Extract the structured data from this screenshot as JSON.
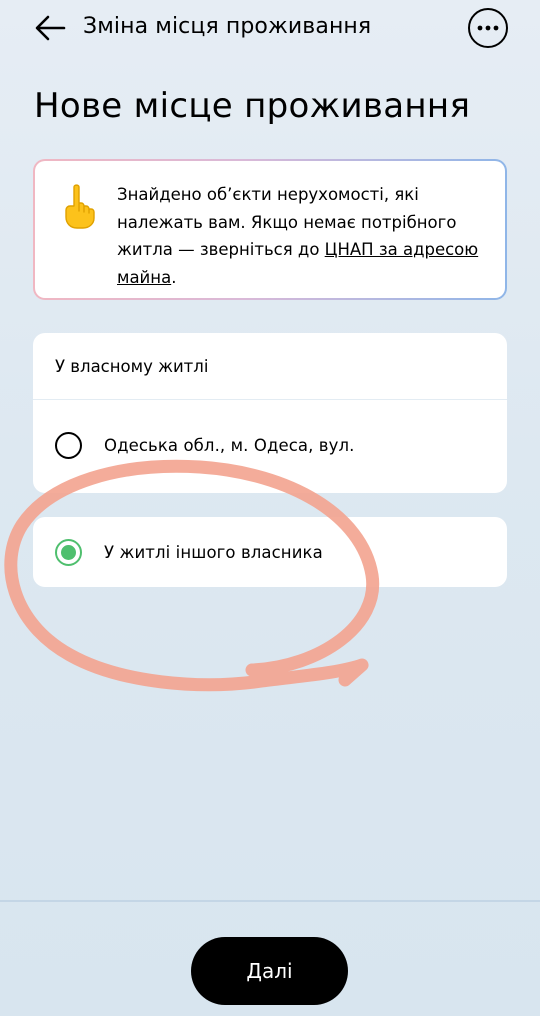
{
  "header": {
    "back_icon": "arrow-left-icon",
    "title": "Зміна місця проживання",
    "more_icon": "more-horizontal-icon"
  },
  "page": {
    "title": "Нове місце проживання"
  },
  "notice": {
    "icon": "pointing-up-hand-emoji",
    "text_before": "Знайдено об’єкти нерухомості, які належать вам. Якщо немає потрібного житла — зверніться до ",
    "link": "ЦНАП за адресою майна",
    "text_after": ".",
    "border_colors": [
      "#f0b7c2",
      "#8fb6e8"
    ]
  },
  "own_housing": {
    "header": "У власному житлі",
    "options": [
      {
        "label": "Одеська обл., м. Одеса, вул.",
        "selected": false
      }
    ]
  },
  "other_owner": {
    "label": "У житлі іншого власника",
    "selected": true
  },
  "footer": {
    "next_label": "Далі"
  },
  "colors": {
    "accent_green": "#4fbf6e",
    "annotation_stroke": "#f3a38f"
  }
}
